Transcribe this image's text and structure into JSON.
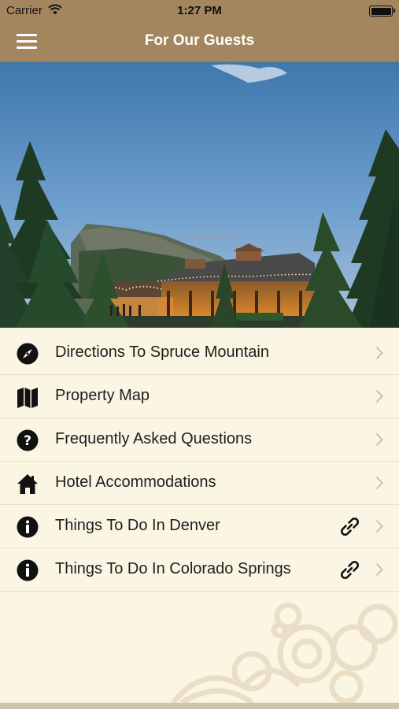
{
  "status_bar": {
    "carrier": "Carrier",
    "time": "1:27 PM"
  },
  "header": {
    "title": "For Our Guests"
  },
  "hero": {
    "image": "rustic lodge at dusk with string lights, pine trees and mountains"
  },
  "menu": [
    {
      "label": "Directions To Spruce Mountain",
      "icon": "compass-icon",
      "external_link": false
    },
    {
      "label": "Property Map",
      "icon": "map-icon",
      "external_link": false
    },
    {
      "label": "Frequently Asked Questions",
      "icon": "question-icon",
      "external_link": false
    },
    {
      "label": "Hotel Accommodations",
      "icon": "house-icon",
      "external_link": false
    },
    {
      "label": "Things To Do In Denver",
      "icon": "info-icon",
      "external_link": true
    },
    {
      "label": "Things To Do In Colorado Springs",
      "icon": "info-icon",
      "external_link": true
    }
  ],
  "colors": {
    "header": "#a3865e",
    "background": "#fbf5e3",
    "divider": "#e7decb",
    "chevron": "#c7c0b3"
  }
}
